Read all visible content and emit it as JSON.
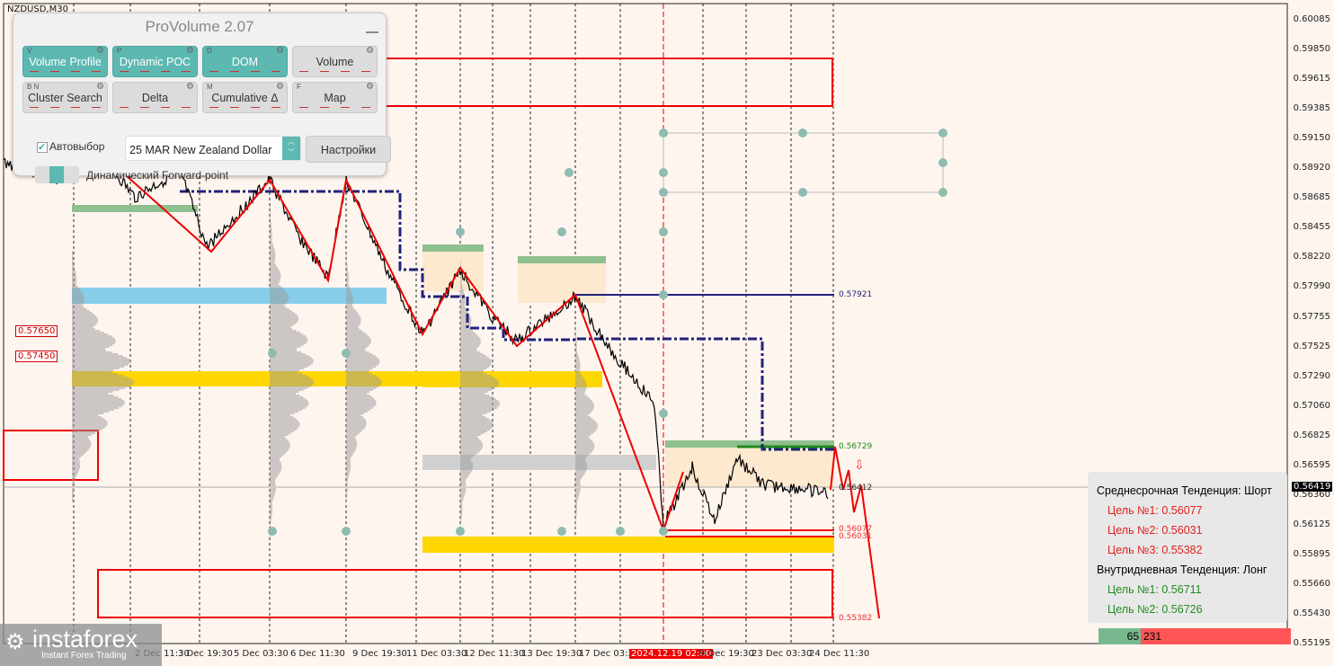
{
  "symbol": "NZDUSD,M30",
  "panel": {
    "title": "ProVolume 2.07",
    "buttons": [
      {
        "key": "V",
        "label": "Volume Profile",
        "on": true
      },
      {
        "key": "P",
        "label": "Dynamic POC",
        "on": true
      },
      {
        "key": "D",
        "label": "DOM",
        "on": true
      },
      {
        "key": "",
        "label": "Volume",
        "on": false
      },
      {
        "key": "B  N",
        "label": "Cluster Search",
        "on": false
      },
      {
        "key": "",
        "label": "Delta",
        "on": false
      },
      {
        "key": "M",
        "label": "Cumulative Δ",
        "on": false
      },
      {
        "key": "F",
        "label": "Map",
        "on": false
      }
    ],
    "autoselect_label": "Автовыбор",
    "autoselect_checked": true,
    "instrument": "25 MAR New Zealand Dollar",
    "settings_label": "Настройки",
    "forward_label": "Динамический Forward-point"
  },
  "price_axis": [
    "0.60085",
    "0.59850",
    "0.59615",
    "0.59385",
    "0.59150",
    "0.58920",
    "0.58685",
    "0.58455",
    "0.58220",
    "0.57990",
    "0.57755",
    "0.57525",
    "0.57290",
    "0.57060",
    "0.56825",
    "0.56595",
    "0.56360",
    "0.56125",
    "0.55895",
    "0.55660",
    "0.55430",
    "0.55195"
  ],
  "current_price": "0.56419",
  "date_axis": [
    "2 Dec 11:30",
    "3 Dec 19:30",
    "5 Dec 03:30",
    "6 Dec 11:30",
    "9 Dec 19:30",
    "11 Dec 03:30",
    "12 Dec 11:30",
    "13 Dec 19:30",
    "17 Dec 03:30",
    "2024.12.19 02:00",
    "9 Dec 19:30",
    "23 Dec 03:30",
    "24 Dec 11:30"
  ],
  "levels": {
    "l1": "0.57921",
    "l2": "0.56729",
    "l3": "0.56412",
    "l4": "0.56077",
    "l5": "0.56031",
    "l6": "0.55382"
  },
  "left_labels": [
    "0.57650",
    "0.57450"
  ],
  "info": {
    "mid_title": "Среднесрочная Тенденция: Шорт",
    "mid_targets": [
      "Цель №1: 0.56077",
      "Цель №2: 0.56031",
      "Цель №3: 0.55382"
    ],
    "intra_title": "Внутридневная Тенденция: Лонг",
    "intra_targets": [
      "Цель №1: 0.56711",
      "Цель №2: 0.56726"
    ]
  },
  "ratio": {
    "buy": "65",
    "sell": "231",
    "buy_fraction": 0.22
  },
  "logo": {
    "name": "instaforex",
    "tagline": "Instant Forex Trading"
  },
  "colors": {
    "teal": "#5cb8b0",
    "red": "#e00000",
    "green": "#1e8a1e",
    "navy": "#22227a",
    "gold": "#ffd700"
  }
}
